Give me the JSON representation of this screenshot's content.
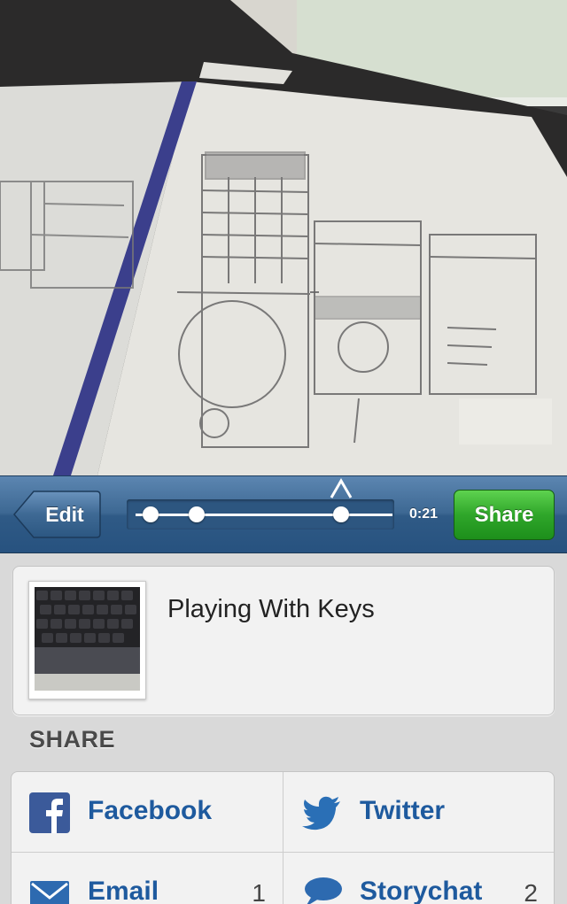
{
  "toolbar": {
    "edit_label": "Edit",
    "time": "0:21",
    "share_label": "Share",
    "timeline_markers": [
      0.09,
      0.26,
      0.8
    ],
    "playhead_position": 0.8
  },
  "story": {
    "title": "Playing With Keys"
  },
  "share_section": {
    "heading": "SHARE",
    "items": [
      {
        "label": "Facebook",
        "icon": "facebook-icon",
        "count": ""
      },
      {
        "label": "Twitter",
        "icon": "twitter-icon",
        "count": ""
      },
      {
        "label": "Email",
        "icon": "email-icon",
        "count": "1"
      },
      {
        "label": "Storychat",
        "icon": "chat-bubble-icon",
        "count": "2"
      }
    ]
  },
  "colors": {
    "toolbar_blue": "#3d6893",
    "share_green": "#2fa62a",
    "link_blue": "#1e5a9e",
    "background": "#d9d9d9",
    "card": "#f2f2f2"
  }
}
